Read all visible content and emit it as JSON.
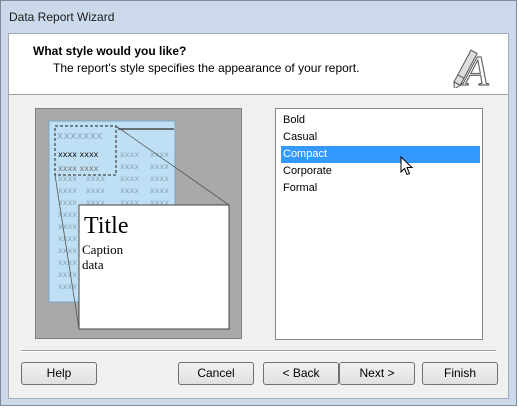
{
  "window": {
    "title": "Data Report Wizard"
  },
  "header": {
    "title": "What style would you like?",
    "subtitle": "The report's style specifies the appearance of your report.",
    "logo_icon": "pencil-letter-a-icon"
  },
  "preview": {
    "header_text": "xxxxxxx",
    "row_bold": "xxxx xxxx",
    "row_faint": "xxxx xxxx",
    "cell_text": "xxxx",
    "title": "Title",
    "caption": "Caption",
    "data": "data"
  },
  "styles": {
    "items": [
      "Bold",
      "Casual",
      "Compact",
      "Corporate",
      "Formal"
    ],
    "selected": "Compact"
  },
  "buttons": {
    "help": "Help",
    "cancel": "Cancel",
    "back": "< Back",
    "next": "Next >",
    "finish": "Finish"
  },
  "colors": {
    "selection": "#3399ff",
    "preview_page": "#bfe0f4",
    "preview_background": "#a9a9a9"
  }
}
